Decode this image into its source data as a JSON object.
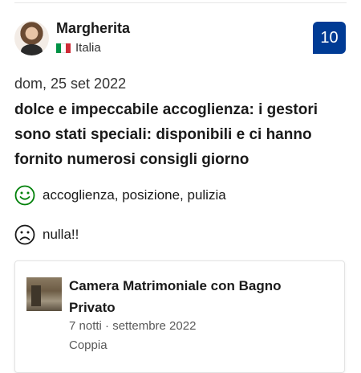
{
  "reviewer": {
    "name": "Margherita",
    "country": "Italia",
    "flag_colors": [
      "#009246",
      "#ffffff",
      "#ce2b37"
    ]
  },
  "score": "10",
  "score_color": "#003b95",
  "review": {
    "date": "dom, 25 set 2022",
    "title": "dolce e impeccabile accoglienza: i gestori sono stati speciali: disponibili e ci hanno fornito numerosi consigli giorno",
    "positive": "accoglienza, posizione, pulizia",
    "positive_icon": "smiley-happy-icon",
    "positive_color": "#008009",
    "negative": "nulla!!",
    "negative_icon": "smiley-sad-icon"
  },
  "stay": {
    "room": "Camera Matrimoniale con Bagno Privato",
    "details": "7 notti · settembre 2022",
    "traveler_type": "Coppia"
  }
}
